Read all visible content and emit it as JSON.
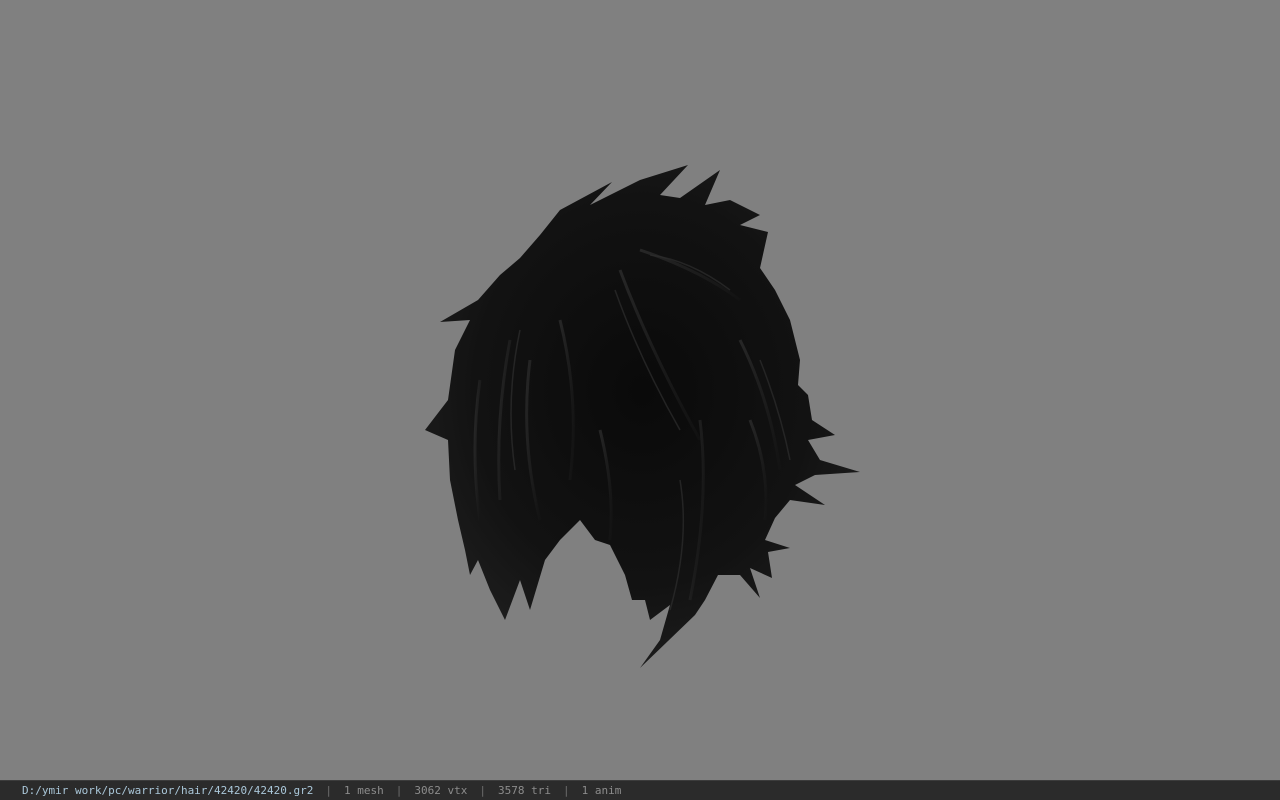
{
  "viewport": {
    "background": "#808080",
    "model_name": "hair-mesh"
  },
  "status": {
    "file_path": "D:/ymir work/pc/warrior/hair/42420/42420.gr2",
    "separator": "|",
    "meshes": "1 mesh",
    "vertices": "3062 vtx",
    "triangles": "3578 tri",
    "animations": "1 anim"
  },
  "colors": {
    "path_text": "#a9c6d8",
    "stat_text": "#8c8c8c",
    "status_bar_bg": "#2b2b2b"
  }
}
